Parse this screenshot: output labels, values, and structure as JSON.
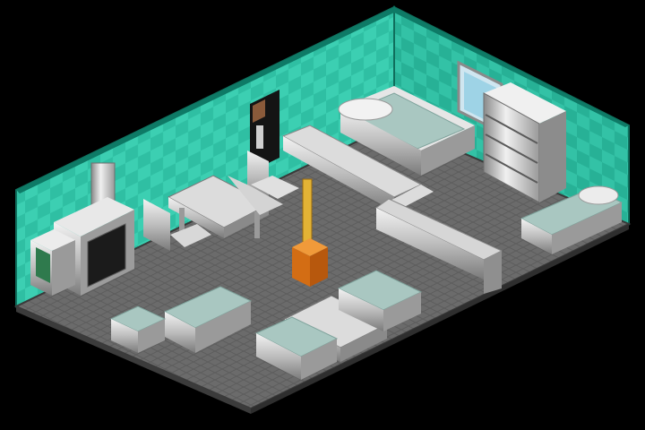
{
  "scene": {
    "type": "isometric-room",
    "theme": "chrome-furniture",
    "colors": {
      "background": "#000000",
      "wall_light": "#2fbfa3",
      "wall_dark": "#1f9c84",
      "wall_check": "#3ccfb2",
      "wall_top": "#159a80",
      "floor": "#6a6a6a",
      "floor_line": "#5a5a5a",
      "chrome_light": "#e9e9e9",
      "chrome_mid": "#b8b8b8",
      "chrome_dark": "#6f6f6f",
      "cushion": "#a9c7c1",
      "cushion_dark": "#86a9a2",
      "trophy_gold": "#e3b335",
      "trophy_base": "#e07d1e"
    },
    "furniture": [
      "fireplace-stove",
      "fridge",
      "dining-table",
      "chair",
      "chair",
      "chair",
      "bed",
      "counter",
      "bookshelf",
      "sofa-bed",
      "trophy",
      "sofa",
      "armchair",
      "coffee-table",
      "armchair",
      "armchair",
      "door",
      "window"
    ]
  }
}
